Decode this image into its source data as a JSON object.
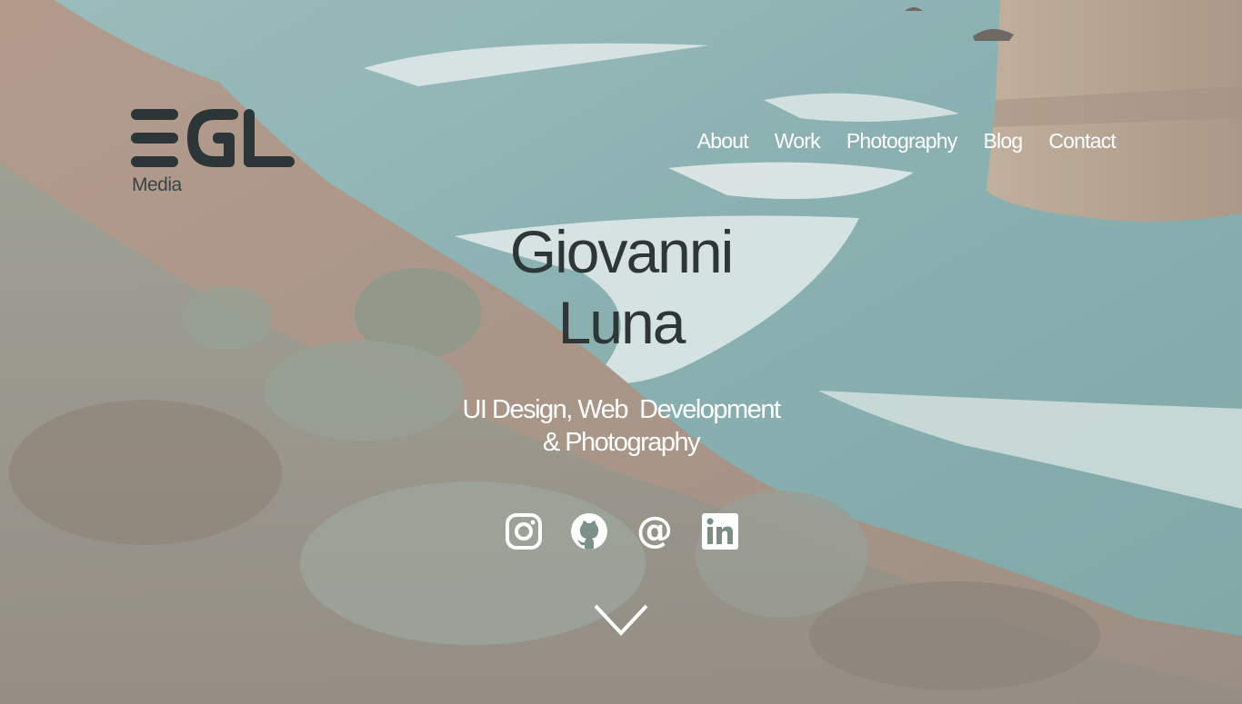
{
  "brand": {
    "logo_text": "EGL",
    "sub_label": "Media",
    "logo_color": "#2c3538"
  },
  "nav": {
    "items": [
      {
        "label": "About"
      },
      {
        "label": "Work"
      },
      {
        "label": "Photography"
      },
      {
        "label": "Blog"
      },
      {
        "label": "Contact"
      }
    ]
  },
  "hero": {
    "name_line1": "Giovanni",
    "name_line2": "Luna",
    "tagline_line1": "UI Design, Web  Development",
    "tagline_line2": "& Photography",
    "name_color": "#2f3638",
    "text_color": "#ffffff"
  },
  "social": {
    "icons": [
      "instagram-icon",
      "github-icon",
      "at-sign-email-icon",
      "linkedin-icon"
    ]
  },
  "scroll": {
    "icon": "chevron-down-icon"
  }
}
